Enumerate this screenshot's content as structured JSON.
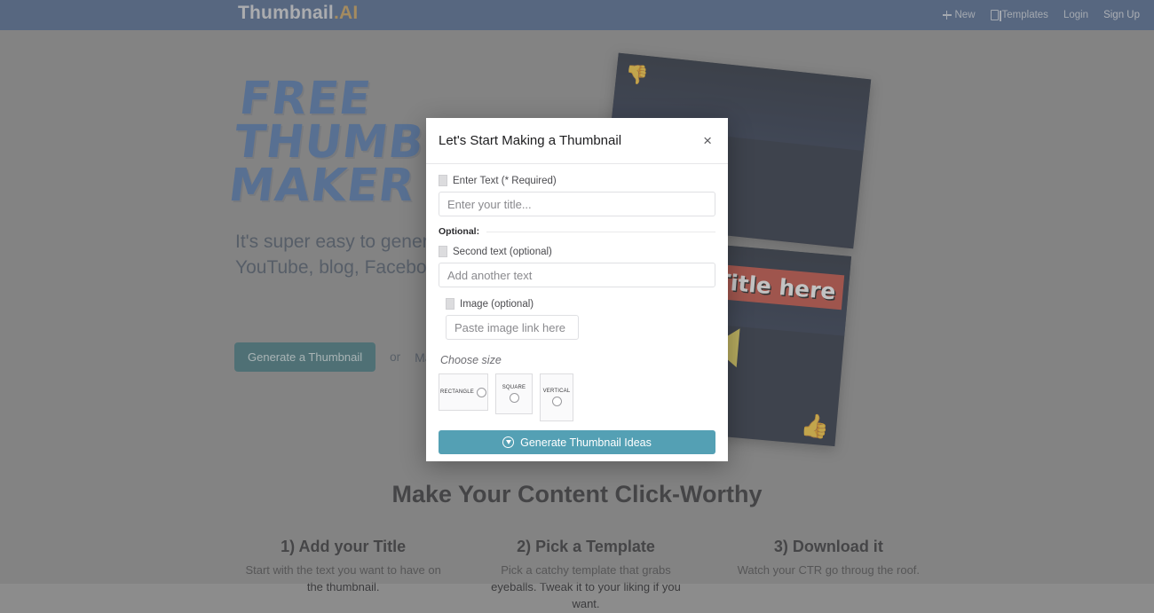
{
  "header": {
    "brand_main": "Thumbnail",
    "brand_suffix": ".AI",
    "nav": [
      {
        "label": "New",
        "icon": "plus-icon"
      },
      {
        "label": "Templates",
        "icon": "template-icon"
      },
      {
        "label": "Login",
        "icon": ""
      },
      {
        "label": "Sign Up",
        "icon": ""
      }
    ]
  },
  "hero": {
    "title_line1": "FREE",
    "title_line2": "THUMBNAIL",
    "title_line3": "MAKER",
    "subtitle": "It's super easy to generate thumbnails for your Shorts, YouTube, blog, Facebook posts. Just enter a title.",
    "cta_primary": "Generate a Thumbnail",
    "cta_or": "or",
    "cta_secondary": "Make from a template"
  },
  "thumbnails": [
    {
      "emoji": "👎",
      "banner": "",
      "name": "thumbnail-preview-bad"
    },
    {
      "emoji": "👍",
      "banner": "Title here",
      "name": "thumbnail-preview-good"
    }
  ],
  "modal": {
    "title": "Let's Start Making a Thumbnail",
    "close_label": "×",
    "required_label": "Enter Text (* Required)",
    "title_placeholder": "Enter your title...",
    "optional_divider": "Optional:",
    "second_text_label": "Second text (optional)",
    "second_text_placeholder": "Add another text",
    "image_label": "Image (optional)",
    "image_placeholder": "Paste image link here",
    "choose_size_label": "Choose size",
    "sizes": [
      {
        "label": "RECTANGLE",
        "selected": false
      },
      {
        "label": "SQUARE",
        "selected": false
      },
      {
        "label": "VERTICAL",
        "selected": false
      }
    ],
    "generate_label": "Generate Thumbnail Ideas",
    "accent_color": "#54a0b4"
  },
  "bottom": {
    "section_title": "Make Your Content Click-Worthy",
    "steps": [
      {
        "title": "1) Add your Title",
        "desc": "Start with the text you want to have on the thumbnail."
      },
      {
        "title": "2) Pick a Template",
        "desc": "Pick a catchy template that grabs eyeballs. Tweak it to your liking if you want."
      },
      {
        "title": "3) Download it",
        "desc": "Watch your CTR go throug the roof."
      }
    ]
  },
  "colors": {
    "header_bg": "#3d5a87",
    "brand_accent": "#c99b4e",
    "hero_blue": "#3f6aa8",
    "cta_teal": "#2f6b74",
    "modal_accent": "#54a0b4",
    "page_bg": "#8c8c8c"
  }
}
